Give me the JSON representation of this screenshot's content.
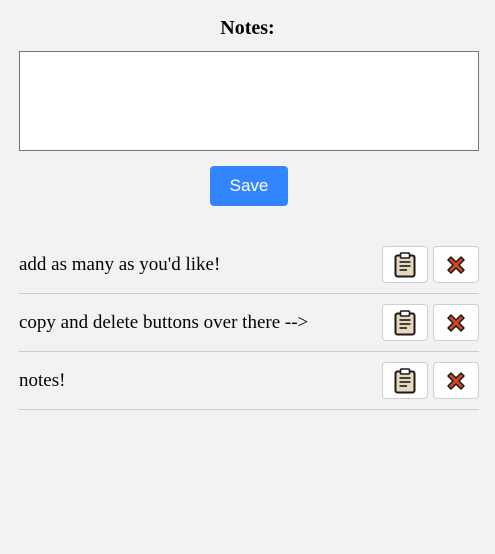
{
  "header": {
    "title": "Notes:"
  },
  "editor": {
    "value": "",
    "placeholder": ""
  },
  "actions": {
    "save_label": "Save"
  },
  "notes": [
    {
      "text": "add as many as you'd like!"
    },
    {
      "text": "copy and delete buttons over there -->"
    },
    {
      "text": "notes!"
    }
  ],
  "icons": {
    "copy": "clipboard-icon",
    "delete": "x-icon"
  },
  "colors": {
    "background": "#f2f2f2",
    "save_button": "#3385ff",
    "delete_icon": "#d6461f",
    "clipboard_icon": "#e8d8be"
  }
}
